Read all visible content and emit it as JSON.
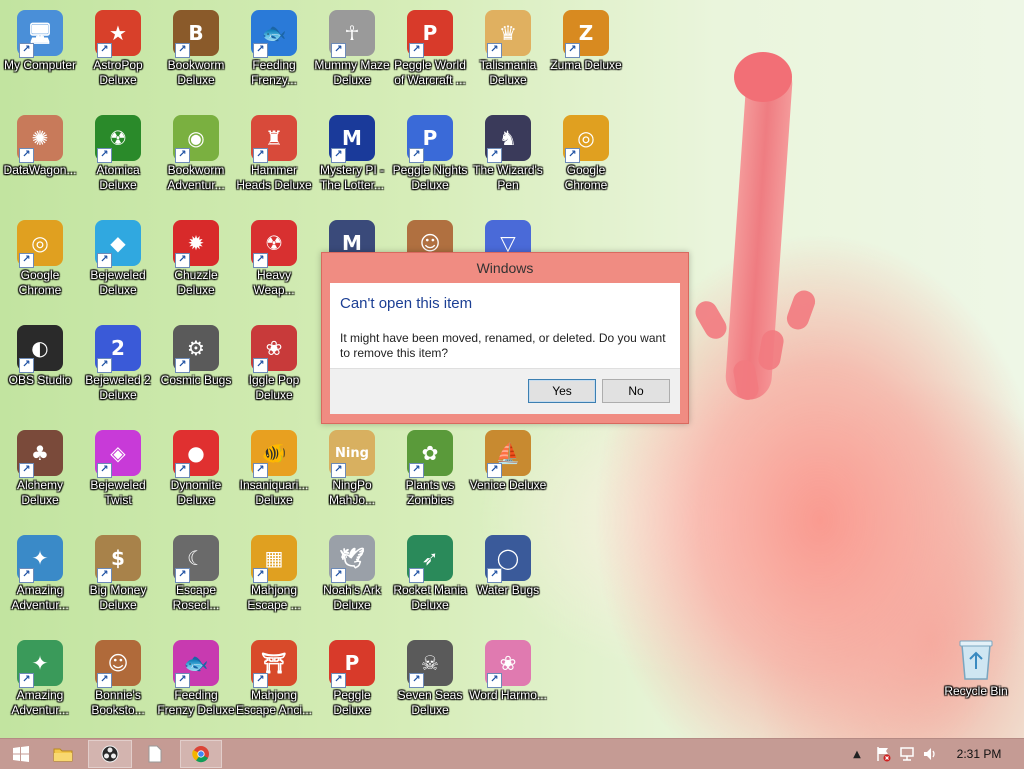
{
  "desktop": {
    "icons": [
      {
        "label": "My Computer",
        "icon": "computer-icon",
        "color": "#4a8fd8",
        "glyph": "🖥"
      },
      {
        "label": "AstroPop Deluxe",
        "icon": "astropop-icon",
        "color": "#d8402a",
        "glyph": "★"
      },
      {
        "label": "Bookworm Deluxe",
        "icon": "bookworm-icon",
        "color": "#8a5a2a",
        "glyph": "B"
      },
      {
        "label": "Feeding Frenzy...",
        "icon": "fish-icon",
        "color": "#2a7ad8",
        "glyph": "🐟"
      },
      {
        "label": "Mummy Maze Deluxe",
        "icon": "mummy-icon",
        "color": "#9a9a9a",
        "glyph": "☥"
      },
      {
        "label": "Peggle World of Warcraft ...",
        "icon": "peggle-icon",
        "color": "#d83a2a",
        "glyph": "P"
      },
      {
        "label": "Talismania Deluxe",
        "icon": "talismania-icon",
        "color": "#e0b060",
        "glyph": "♛"
      },
      {
        "label": "Zuma Deluxe",
        "icon": "zuma-icon",
        "color": "#d88a20",
        "glyph": "Z"
      },
      {
        "label": "DataWagon...",
        "icon": "datawagon-icon",
        "color": "#c87a5a",
        "glyph": "✺"
      },
      {
        "label": "Atomica Deluxe",
        "icon": "atomica-icon",
        "color": "#2a8a2a",
        "glyph": "☢"
      },
      {
        "label": "Bookworm Adventur...",
        "icon": "bookworm-adventures-icon",
        "color": "#7ab040",
        "glyph": "◉"
      },
      {
        "label": "Hammer Heads Deluxe",
        "icon": "gnome-icon",
        "color": "#d84a3a",
        "glyph": "♜"
      },
      {
        "label": "Mystery PI - The Lotter...",
        "icon": "mystery-pi-icon",
        "color": "#1a3a9a",
        "glyph": "M"
      },
      {
        "label": "Peggle Nights Deluxe",
        "icon": "peggle-nights-icon",
        "color": "#3a6ad8",
        "glyph": "P"
      },
      {
        "label": "The Wizard's Pen",
        "icon": "wizard-icon",
        "color": "#3a3a5a",
        "glyph": "♞"
      },
      {
        "label": "Google Chrome",
        "icon": "chrome-icon",
        "color": "#e0a020",
        "glyph": "◎"
      },
      {
        "label": "Google Chrome",
        "icon": "chrome-icon",
        "color": "#e0a020",
        "glyph": "◎"
      },
      {
        "label": "Bejeweled Deluxe",
        "icon": "diamond-icon",
        "color": "#30a8e0",
        "glyph": "◆"
      },
      {
        "label": "Chuzzle Deluxe",
        "icon": "chuzzle-icon",
        "color": "#d82a2a",
        "glyph": "✹"
      },
      {
        "label": "Heavy Weap...",
        "icon": "radiation-icon",
        "color": "#d83030",
        "glyph": "☢"
      },
      {
        "label": "",
        "icon": "mystery-pi-shield-icon",
        "color": "#3a4a7a",
        "glyph": "M"
      },
      {
        "label": "",
        "icon": "character-icon",
        "color": "#b07040",
        "glyph": "☺"
      },
      {
        "label": "",
        "icon": "cocktail-icon",
        "color": "#4a6ad8",
        "glyph": "▽"
      },
      null,
      {
        "label": "OBS Studio",
        "icon": "obs-icon",
        "color": "#2a2a2a",
        "glyph": "◐"
      },
      {
        "label": "Bejeweled 2 Deluxe",
        "icon": "bejeweled2-icon",
        "color": "#3a5ad8",
        "glyph": "2"
      },
      {
        "label": "Cosmic Bugs",
        "icon": "gear-icon",
        "color": "#5a5a5a",
        "glyph": "⚙"
      },
      {
        "label": "Iggle Pop Deluxe",
        "icon": "iggle-icon",
        "color": "#c83a3a",
        "glyph": "❀"
      },
      {
        "label": "",
        "icon": "partial-icon",
        "color": "#7a7a7a",
        "glyph": ""
      },
      null,
      null,
      null,
      {
        "label": "Alchemy Deluxe",
        "icon": "alchemy-icon",
        "color": "#7a4a3a",
        "glyph": "♣"
      },
      {
        "label": "Bejeweled Twist",
        "icon": "bejeweled-twist-icon",
        "color": "#c83ad8",
        "glyph": "◈"
      },
      {
        "label": "Dynomite Deluxe",
        "icon": "egg-icon",
        "color": "#e03030",
        "glyph": "●"
      },
      {
        "label": "Insaniquari... Deluxe",
        "icon": "goldfish-icon",
        "color": "#e8a020",
        "glyph": "🐠"
      },
      {
        "label": "NingPo MahJo...",
        "icon": "ningpo-icon",
        "color": "#d8b060",
        "glyph": "Ning"
      },
      {
        "label": "Plants vs Zombies",
        "icon": "plant-icon",
        "color": "#5a9a3a",
        "glyph": "✿"
      },
      {
        "label": "Venice Deluxe",
        "icon": "gondola-icon",
        "color": "#c88a30",
        "glyph": "⛵"
      },
      null,
      {
        "label": "Amazing Adventur...",
        "icon": "compass-icon",
        "color": "#3a8ac8",
        "glyph": "✦"
      },
      {
        "label": "Big Money Deluxe",
        "icon": "money-bag-icon",
        "color": "#a8824a",
        "glyph": "$"
      },
      {
        "label": "Escape Rosecl...",
        "icon": "moon-icon",
        "color": "#6a6a6a",
        "glyph": "☾"
      },
      {
        "label": "Mahjong Escape ...",
        "icon": "mahjong-icon",
        "color": "#e0a020",
        "glyph": "▦"
      },
      {
        "label": "Noah's Ark Deluxe",
        "icon": "dove-icon",
        "color": "#9aa0a8",
        "glyph": "🕊"
      },
      {
        "label": "Rocket Mania Deluxe",
        "icon": "rocket-icon",
        "color": "#2a8a5a",
        "glyph": "➶"
      },
      {
        "label": "Water Bugs",
        "icon": "porthole-icon",
        "color": "#3a5a9a",
        "glyph": "◯"
      },
      null,
      {
        "label": "Amazing Adventur...",
        "icon": "globe-icon",
        "color": "#3a9a5a",
        "glyph": "✦"
      },
      {
        "label": "Bonnie's Booksto...",
        "icon": "bonnie-icon",
        "color": "#b06a3a",
        "glyph": "☺"
      },
      {
        "label": "Feeding Frenzy Deluxe",
        "icon": "fish-icon",
        "color": "#c83ab0",
        "glyph": "🐟"
      },
      {
        "label": "Mahjong Escape Anci...",
        "icon": "torii-icon",
        "color": "#d84a2a",
        "glyph": "⛩"
      },
      {
        "label": "Peggle Deluxe",
        "icon": "peggle-icon",
        "color": "#d83a2a",
        "glyph": "P"
      },
      {
        "label": "Seven Seas Deluxe",
        "icon": "skull-icon",
        "color": "#5a5a5a",
        "glyph": "☠"
      },
      {
        "label": "Word Harmo...",
        "icon": "flower-icon",
        "color": "#e07ab0",
        "glyph": "❀"
      },
      null
    ],
    "recycle_bin": {
      "label": "Recycle Bin",
      "icon": "recycle-bin-icon"
    }
  },
  "dialog": {
    "title": "Windows",
    "heading": "Can't open this item",
    "message": "It might have been moved, renamed, or deleted. Do you want to remove this item?",
    "yes_label": "Yes",
    "no_label": "No"
  },
  "taskbar": {
    "buttons": [
      {
        "icon": "windows-start-icon"
      },
      {
        "icon": "file-explorer-icon"
      },
      {
        "icon": "obs-icon",
        "active": true
      },
      {
        "icon": "notepad-icon"
      },
      {
        "icon": "chrome-icon",
        "active": true
      }
    ],
    "tray": [
      "chevron-up-icon",
      "action-center-flag-icon",
      "network-icon",
      "volume-icon"
    ],
    "clock": "2:31 PM"
  }
}
